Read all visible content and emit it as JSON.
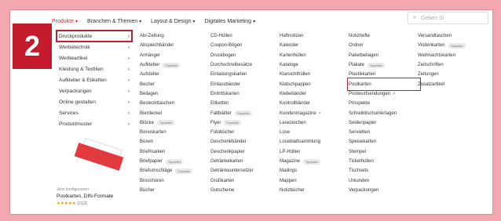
{
  "step_number": "2",
  "top_nav": [
    {
      "label": "Produkte",
      "active": true
    },
    {
      "label": "Branchen & Themen",
      "active": false
    },
    {
      "label": "Layout & Design",
      "active": false
    },
    {
      "label": "Digitales Marketing",
      "active": false
    }
  ],
  "caret": "▾",
  "search": {
    "placeholder": "Geben Si",
    "icon": "⌕"
  },
  "sidebar": [
    "Druckprodukte",
    "Werbetechnik",
    "Werbeartikel",
    "Kleidung & Textilien",
    "Aufkleber & Etiketten",
    "Verpackungen",
    "Online gestalten",
    "Services",
    "Produktmuster"
  ],
  "sidebar_arrow": "›",
  "promo": {
    "small": "Jetzt konfigurieren",
    "name": "Postkarten, DIN-Formate",
    "stars": "★★★★★",
    "rating": "(213)"
  },
  "badge_topseller": "Topseller",
  "external_icon": "↗",
  "columns": [
    [
      "Abi-Zeitung",
      "Abspeichbänder",
      "Anhänger",
      "Aufkleber",
      "Aufsteller",
      "Becher",
      "Beilagen",
      "Besteckttaschen",
      "Bierdeckel",
      "Blöcke",
      "Bonuskarten",
      "Boxen",
      "Briefmarken",
      "Briefpapier",
      "Briefumschläge",
      "Broschüren",
      "Bücher"
    ],
    [
      "CD-Hüllen",
      "Coupon-Bögen",
      "Druckbogen",
      "Durchschreibesätze",
      "Einladungskarten",
      "Einlassbänder",
      "Eintrittskarten",
      "Etiketten",
      "Faltblätter",
      "Flyer",
      "Fotobücher",
      "Geschenkbänder",
      "Geschenkpapier",
      "Getränkekarten",
      "Getränkeuntersetzer",
      "Grußkarten",
      "Gutscheine"
    ],
    [
      "Haftnotizen",
      "Kalender",
      "Kartenhüllen",
      "Kataloge",
      "Klarsichthüllen",
      "Klatschpappen",
      "Klebebänder",
      "Kontrollbänder",
      "Kundenmagazine",
      "Lesezeichen",
      "Lose",
      "Loseblattsammlung",
      "LP-Hüllen",
      "Magazine",
      "Mailings",
      "Mappen",
      "Notizbücher"
    ],
    [
      "Notizhefte",
      "Ordner",
      "Paketbeilagen",
      "Plakate",
      "Plastikkarten",
      "Postkarten",
      "Postwurfsendungen",
      "Prospekte",
      "Schreibtischunterlagen",
      "Seidenpapier",
      "Servietten",
      "Speisekarten",
      "Stempel",
      "Tickethüllen",
      "Tischsets",
      "Urkunden",
      "Verpackungen"
    ],
    [
      "Versandtaschen",
      "Visitenkarten",
      "Weihnachtskarten",
      "Zeitschriften",
      "Zeitungen",
      "Zusatzartikel"
    ]
  ]
}
